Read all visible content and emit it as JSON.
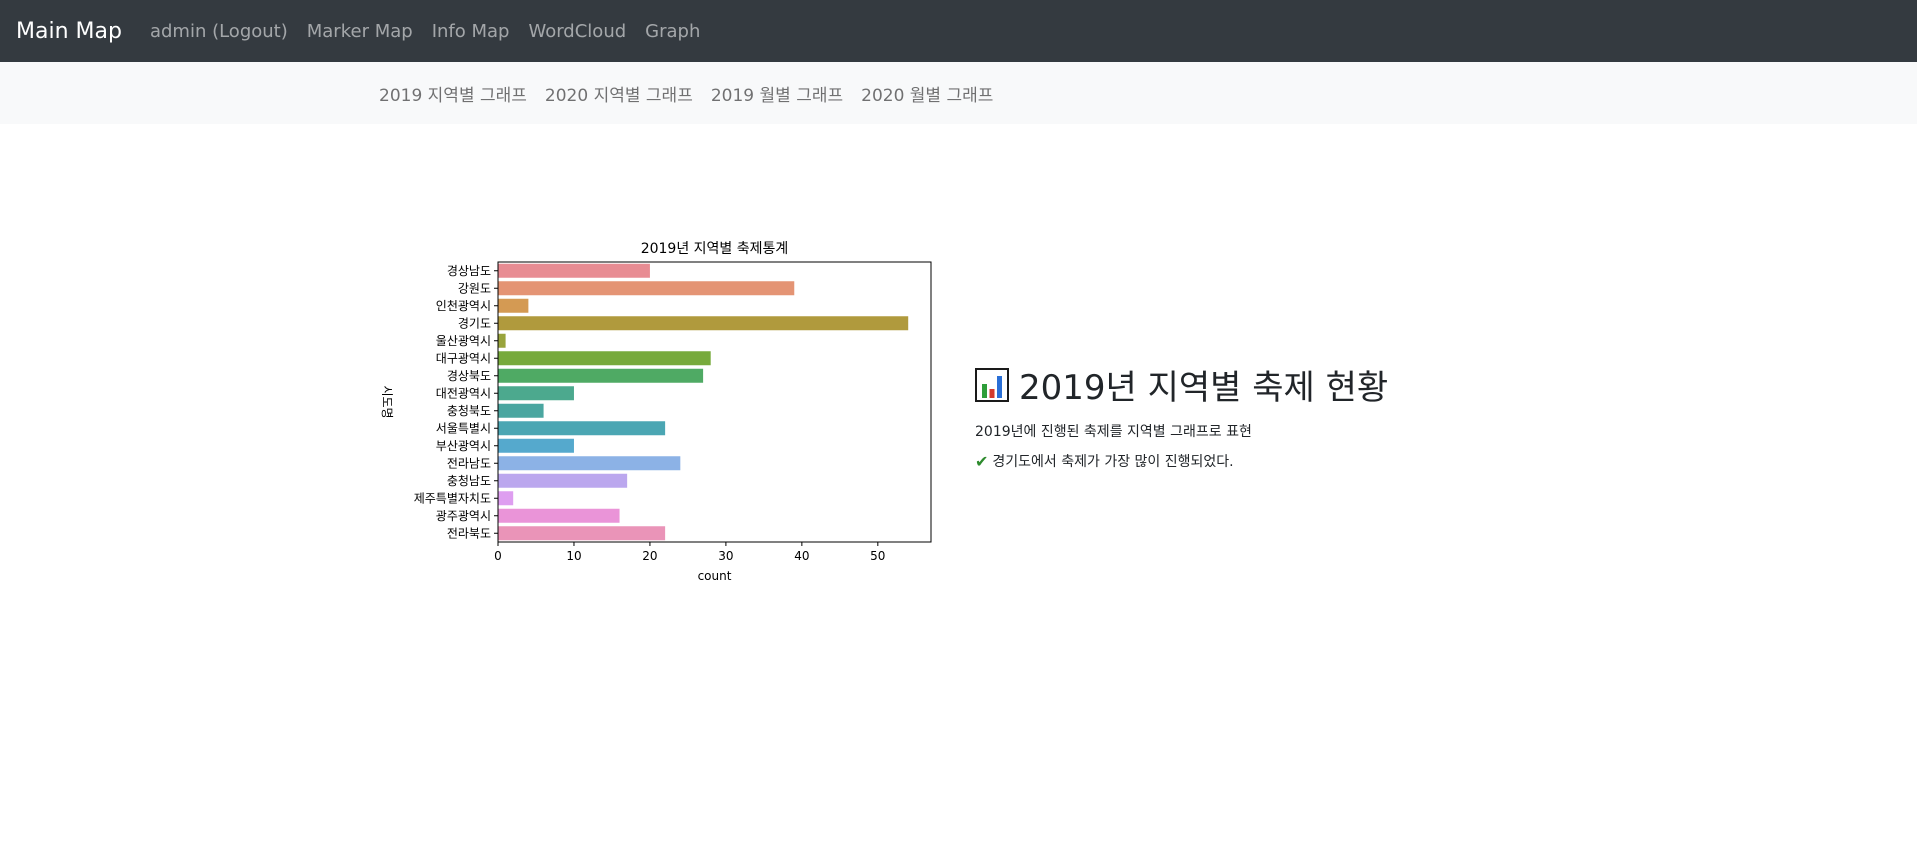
{
  "nav": {
    "brand": "Main Map",
    "links": [
      "admin (Logout)",
      "Marker Map",
      "Info Map",
      "WordCloud",
      "Graph"
    ]
  },
  "subnav": {
    "links": [
      "2019 지역별 그래프",
      "2020 지역별 그래프",
      "2019 월별 그래프",
      "2020 월별 그래프"
    ]
  },
  "info": {
    "icon": "bar-chart-emoji-icon",
    "title": "2019년 지역별 축제 현황",
    "description": "2019년에 진행된 축제를 지역별 그래프로 표현",
    "note": "경기도에서 축제가 가장 많이 진행되었다.",
    "check_icon": "check-mark-icon"
  },
  "chart_data": {
    "type": "bar",
    "orientation": "horizontal",
    "title": "2019년 지역별 축제통계",
    "xlabel": "count",
    "ylabel": "시도명",
    "xlim": [
      0,
      57
    ],
    "xticks": [
      0,
      10,
      20,
      30,
      40,
      50
    ],
    "grid": false,
    "categories": [
      "경상남도",
      "강원도",
      "인천광역시",
      "경기도",
      "울산광역시",
      "대구광역시",
      "경상북도",
      "대전광역시",
      "충청북도",
      "서울특별시",
      "부산광역시",
      "전라남도",
      "충청남도",
      "제주특별자치도",
      "광주광역시",
      "전라북도"
    ],
    "values": [
      20,
      39,
      4,
      54,
      1,
      28,
      27,
      10,
      6,
      22,
      10,
      24,
      17,
      2,
      16,
      22
    ],
    "colors": [
      "#e88c93",
      "#e49474",
      "#d49a53",
      "#b09a3d",
      "#99a43c",
      "#77aa3c",
      "#4faa64",
      "#4ca98e",
      "#4aa6a0",
      "#4ba6b3",
      "#55a9cd",
      "#8cb2e6",
      "#bba7ee",
      "#de9ef0",
      "#ea94d8",
      "#ea94b8"
    ]
  }
}
